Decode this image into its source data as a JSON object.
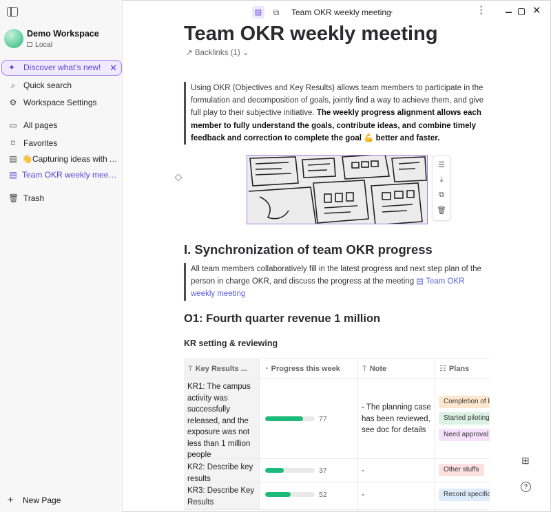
{
  "window": {
    "title": "Team OKR weekly meeting"
  },
  "sidebar": {
    "workspace": {
      "name": "Demo Workspace",
      "storage": "Local"
    },
    "discover": "Discover what's new!",
    "quick_search": "Quick search",
    "workspace_settings": "Workspace Settings",
    "all_pages": "All pages",
    "favorites": "Favorites",
    "fav_items": [
      "👋Capturing ideas with AFFiNE",
      "Team OKR weekly meeting"
    ],
    "trash": "Trash",
    "new_page": "New Page"
  },
  "doc": {
    "title": "Team OKR weekly meeting",
    "backlinks": "Backlinks (1)",
    "intro": {
      "plain": "Using OKR (Objectives and Key Results) allows team members to participate in the formulation and decomposition of goals, jointly find a way to achieve them, and give full play to their subjective initiative. ",
      "bold": "The weekly progress alignment allows each member to fully understand the goals, contribute ideas, and combine timely feedback and correction to complete the goal 💪 better and faster."
    },
    "section1": "I. Synchronization of team OKR progress",
    "section1_text": "All team members collaboratively fill in the latest progress and next step plan of the person in charge OKR, and discuss the progress at the meeting ",
    "section1_link": "Team OKR weekly meeting",
    "o1": "O1: Fourth quarter revenue 1 million",
    "kr_heading": "KR setting & reviewing",
    "table": {
      "headers": [
        "Key Results ...",
        "Progress this week",
        "Note",
        "Plans"
      ],
      "rows": [
        {
          "kr": "KR1: The campus activity was successfully released, and the exposure was not less than 1 million people",
          "progress": 77,
          "note": "- The planning case has been reviewed, see doc for details",
          "plans": [
            {
              "label": "Completion of beta",
              "color": "#fde8cf"
            },
            {
              "label": "Started piloting",
              "color": "#ddf2e4"
            },
            {
              "label": "Need approval of",
              "color": "#f6e3fb"
            }
          ]
        },
        {
          "kr": "KR2: Describe key results",
          "progress": 37,
          "note": "-",
          "plans": [
            {
              "label": "Other stuffs",
              "color": "#fde0e0"
            }
          ]
        },
        {
          "kr": "KR3: Describe Key Results",
          "progress": 52,
          "note": "-",
          "plans": [
            {
              "label": "Record specific results",
              "color": "#dcecfb"
            }
          ]
        }
      ]
    }
  },
  "colors": {
    "accent": "#5b3fd6",
    "progress": "#1dbb7a"
  }
}
